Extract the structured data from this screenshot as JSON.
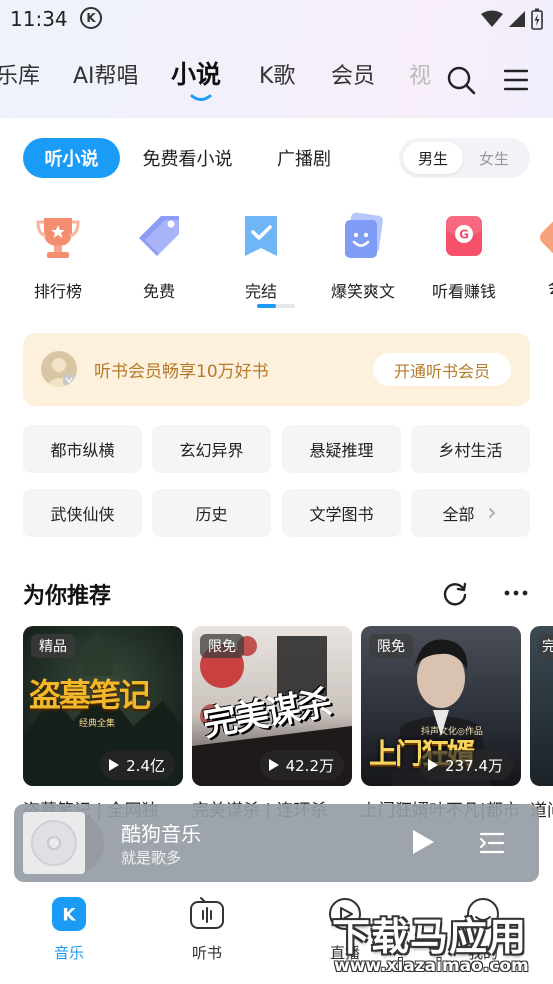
{
  "status": {
    "time": "11:34",
    "app_badge": "K"
  },
  "top_tabs": [
    {
      "label": "乐库"
    },
    {
      "label": "AI帮唱"
    },
    {
      "label": "小说"
    },
    {
      "label": "K歌"
    },
    {
      "label": "会员"
    },
    {
      "label": "视"
    }
  ],
  "sub_tabs": [
    {
      "label": "听小说"
    },
    {
      "label": "免费看小说"
    },
    {
      "label": "广播剧"
    }
  ],
  "gender": {
    "male": "男生",
    "female": "女生"
  },
  "categories": [
    {
      "label": "排行榜",
      "icon": "trophy-icon"
    },
    {
      "label": "免费",
      "icon": "tag-icon"
    },
    {
      "label": "完结",
      "icon": "bookmark-check-icon"
    },
    {
      "label": "爆笑爽文",
      "icon": "smile-card-icon"
    },
    {
      "label": "听看赚钱",
      "icon": "coin-card-icon"
    },
    {
      "label": "会",
      "icon": "partial-icon"
    }
  ],
  "vip": {
    "text": "听书会员畅享10万好书",
    "button": "开通听书会员"
  },
  "genres": [
    {
      "label": "都市纵横"
    },
    {
      "label": "玄幻异界"
    },
    {
      "label": "悬疑推理"
    },
    {
      "label": "乡村生活"
    },
    {
      "label": "武侠仙侠"
    },
    {
      "label": "历史"
    },
    {
      "label": "文学图书"
    },
    {
      "label": "全部"
    }
  ],
  "recommend": {
    "title": "为你推荐",
    "books": [
      {
        "badge": "精品",
        "plays": "2.4亿",
        "cover_text": "盗墓笔记",
        "cover_sub": "经典全集",
        "name": "盗墓笔记 | 全网独"
      },
      {
        "badge": "限免",
        "plays": "42.2万",
        "cover_text": "完美谋杀",
        "name": "完美谋杀 | 连环杀"
      },
      {
        "badge": "限免",
        "plays": "237.4万",
        "cover_text": "上门狂婿",
        "cover_sub": "抖声文化◎作品",
        "name": "上门狂婿叶不凡|都市"
      },
      {
        "badge": "完",
        "name": "道问"
      }
    ]
  },
  "player": {
    "title": "酷狗音乐",
    "subtitle": "就是歌多"
  },
  "bottom_nav": [
    {
      "label": "音乐",
      "icon": "kugou-k-icon"
    },
    {
      "label": "听书",
      "icon": "radio-icon"
    },
    {
      "label": "直播",
      "icon": "live-icon"
    },
    {
      "label": "我的",
      "icon": "profile-icon"
    }
  ],
  "watermark": {
    "main": "下载马应用",
    "sub": "www.xiazaimao.com"
  },
  "colors": {
    "accent": "#1a9cf6",
    "vip_text": "#b57b2c",
    "vip_bg": "#fdf1dd"
  }
}
